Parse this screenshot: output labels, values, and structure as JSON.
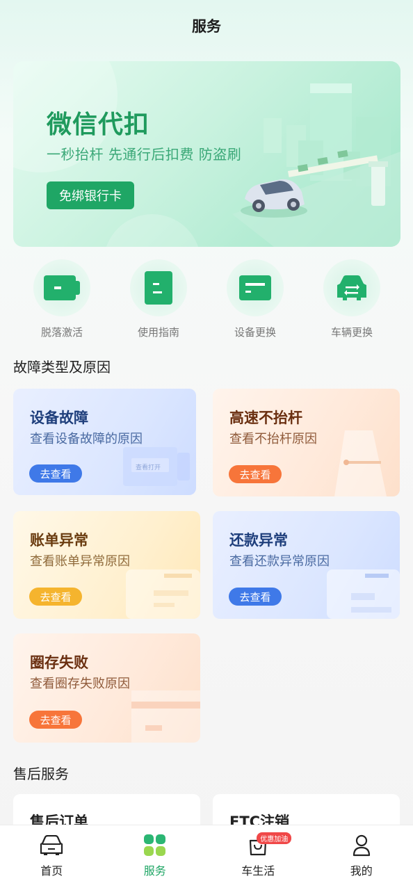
{
  "header": {
    "title": "服务"
  },
  "banner": {
    "title": "微信代扣",
    "subtitle": "一秒抬杆 先通行后扣费 防盗刷",
    "button_label": "免绑银行卡"
  },
  "quick_actions": [
    {
      "label": "脱落激活",
      "icon": "device-card-icon"
    },
    {
      "label": "使用指南",
      "icon": "guide-book-icon"
    },
    {
      "label": "设备更换",
      "icon": "card-swap-icon"
    },
    {
      "label": "车辆更换",
      "icon": "car-swap-icon"
    }
  ],
  "faults": {
    "section_title": "故障类型及原因",
    "cards": [
      {
        "title": "设备故障",
        "desc": "查看设备故障的原因",
        "button": "去查看",
        "deco_text": "查看打开"
      },
      {
        "title": "高速不抬杆",
        "desc": "查看不抬杆原因",
        "button": "去查看"
      },
      {
        "title": "账单异常",
        "desc": "查看账单异常原因",
        "button": "去查看"
      },
      {
        "title": "还款异常",
        "desc": "查看还款异常原因",
        "button": "去查看"
      },
      {
        "title": "圈存失败",
        "desc": "查看圈存失败原因",
        "button": "去查看"
      }
    ]
  },
  "after_sales": {
    "section_title": "售后服务",
    "cards": [
      {
        "title": "售后订单"
      },
      {
        "title": "ETC注销"
      }
    ]
  },
  "tabbar": {
    "items": [
      {
        "label": "首页",
        "icon": "car-front-icon",
        "active": false
      },
      {
        "label": "服务",
        "icon": "grid-icon",
        "active": true
      },
      {
        "label": "车生活",
        "icon": "shopping-bag-icon",
        "active": false,
        "badge": "优惠加油"
      },
      {
        "label": "我的",
        "icon": "user-icon",
        "active": false
      }
    ]
  },
  "colors": {
    "brand_green": "#1fa665",
    "blue_button": "#3f79e8",
    "orange_button": "#f7753a",
    "yellow_button": "#f5b42e"
  }
}
